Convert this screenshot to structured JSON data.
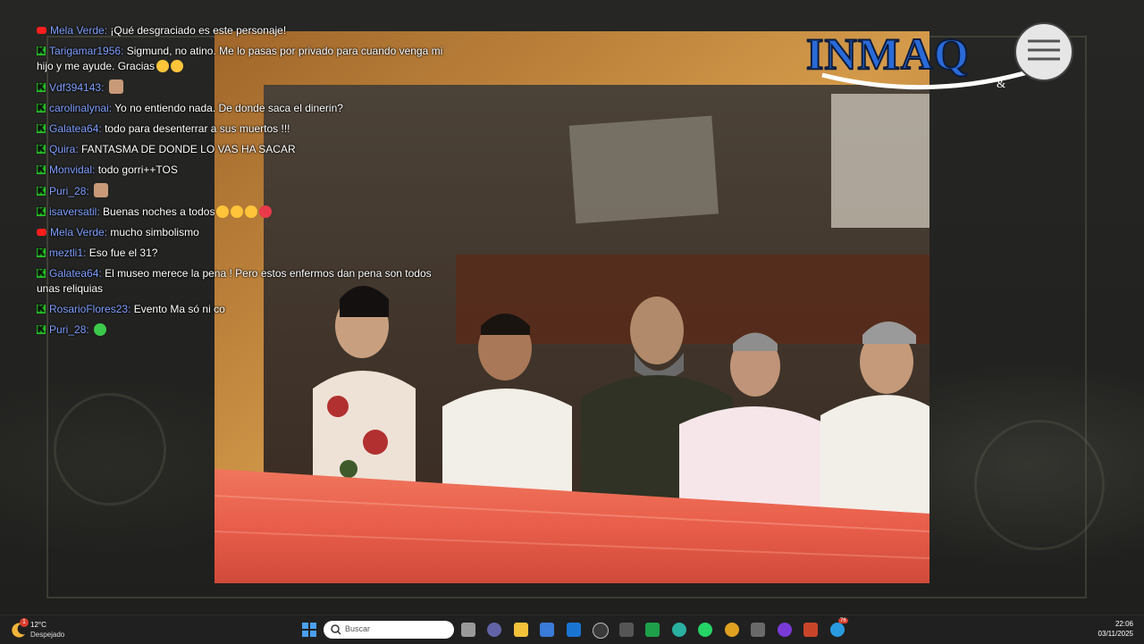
{
  "chat": {
    "messages": [
      {
        "platform": "youtube",
        "user": "Mela Verde",
        "text": "¡Qué desgraciado es este personaje!",
        "emojis": []
      },
      {
        "platform": "kick",
        "user": "Tarigamar1956",
        "text": "Sigmund, no atino. Me lo pasas por privado para cuando venga mi hijo y me ayude. Gracias",
        "emojis": [
          "smiling-face",
          "kissing-face"
        ]
      },
      {
        "platform": "kick",
        "user": "Vdf394143",
        "text": "",
        "emojis": [
          "sticker"
        ]
      },
      {
        "platform": "kick",
        "user": "carolinalynai",
        "text": "Yo no entiendo nada. De donde saca el dinerin?",
        "emojis": []
      },
      {
        "platform": "kick",
        "user": "Galatea64",
        "text": "todo para desenterrar a sus muertos !!!",
        "emojis": []
      },
      {
        "platform": "kick",
        "user": "Quira",
        "text": "FANTASMA DE DONDE LO VAS HA SACAR",
        "emojis": []
      },
      {
        "platform": "kick",
        "user": "Monvidal",
        "text": "todo gorri++TOS",
        "emojis": []
      },
      {
        "platform": "kick",
        "user": "Puri_28",
        "text": "",
        "emojis": [
          "sticker"
        ]
      },
      {
        "platform": "kick",
        "user": "isaversatil",
        "text": "Buenas noches a todos",
        "emojis": [
          "waving-hand",
          "kissing-face",
          "smiling-face",
          "heart"
        ]
      },
      {
        "platform": "youtube",
        "user": "Mela Verde",
        "text": "mucho simbolismo",
        "emojis": []
      },
      {
        "platform": "kick",
        "user": "meztli1",
        "text": "Eso fue el 31?",
        "emojis": []
      },
      {
        "platform": "kick",
        "user": "Galatea64",
        "text": "El museo merece la pena ! Pero estos enfermos dan pena son todos unas reliquias",
        "emojis": []
      },
      {
        "platform": "kick",
        "user": "RosarioFlores23",
        "text": "Evento Ma só ni co",
        "emojis": []
      },
      {
        "platform": "kick",
        "user": "Puri_28",
        "text": "",
        "emojis": [
          "green-face"
        ]
      }
    ]
  },
  "logo": {
    "text": "INMAQ",
    "suffix": "&"
  },
  "taskbar": {
    "weather": {
      "temp": "12°C",
      "condition": "Despejado",
      "notification": "1"
    },
    "search_placeholder": "Buscar",
    "clock": {
      "time": "22:06",
      "date": "03/11/2025"
    },
    "apps": [
      "windows-start-icon",
      "task-view-icon",
      "teams-icon",
      "file-explorer-icon",
      "store-icon",
      "outlook-icon",
      "chatgpt-icon",
      "app-icon",
      "camtasia-icon",
      "edge-icon",
      "whatsapp-icon",
      "chrome-icon",
      "app2-icon",
      "app3-icon",
      "powerpoint-icon",
      "telegram-icon"
    ],
    "badges": {
      "telegram": "76"
    }
  },
  "colors": {
    "username": "#7e9fff",
    "kick_green": "#29d329",
    "youtube_red": "#ff1f1f"
  }
}
